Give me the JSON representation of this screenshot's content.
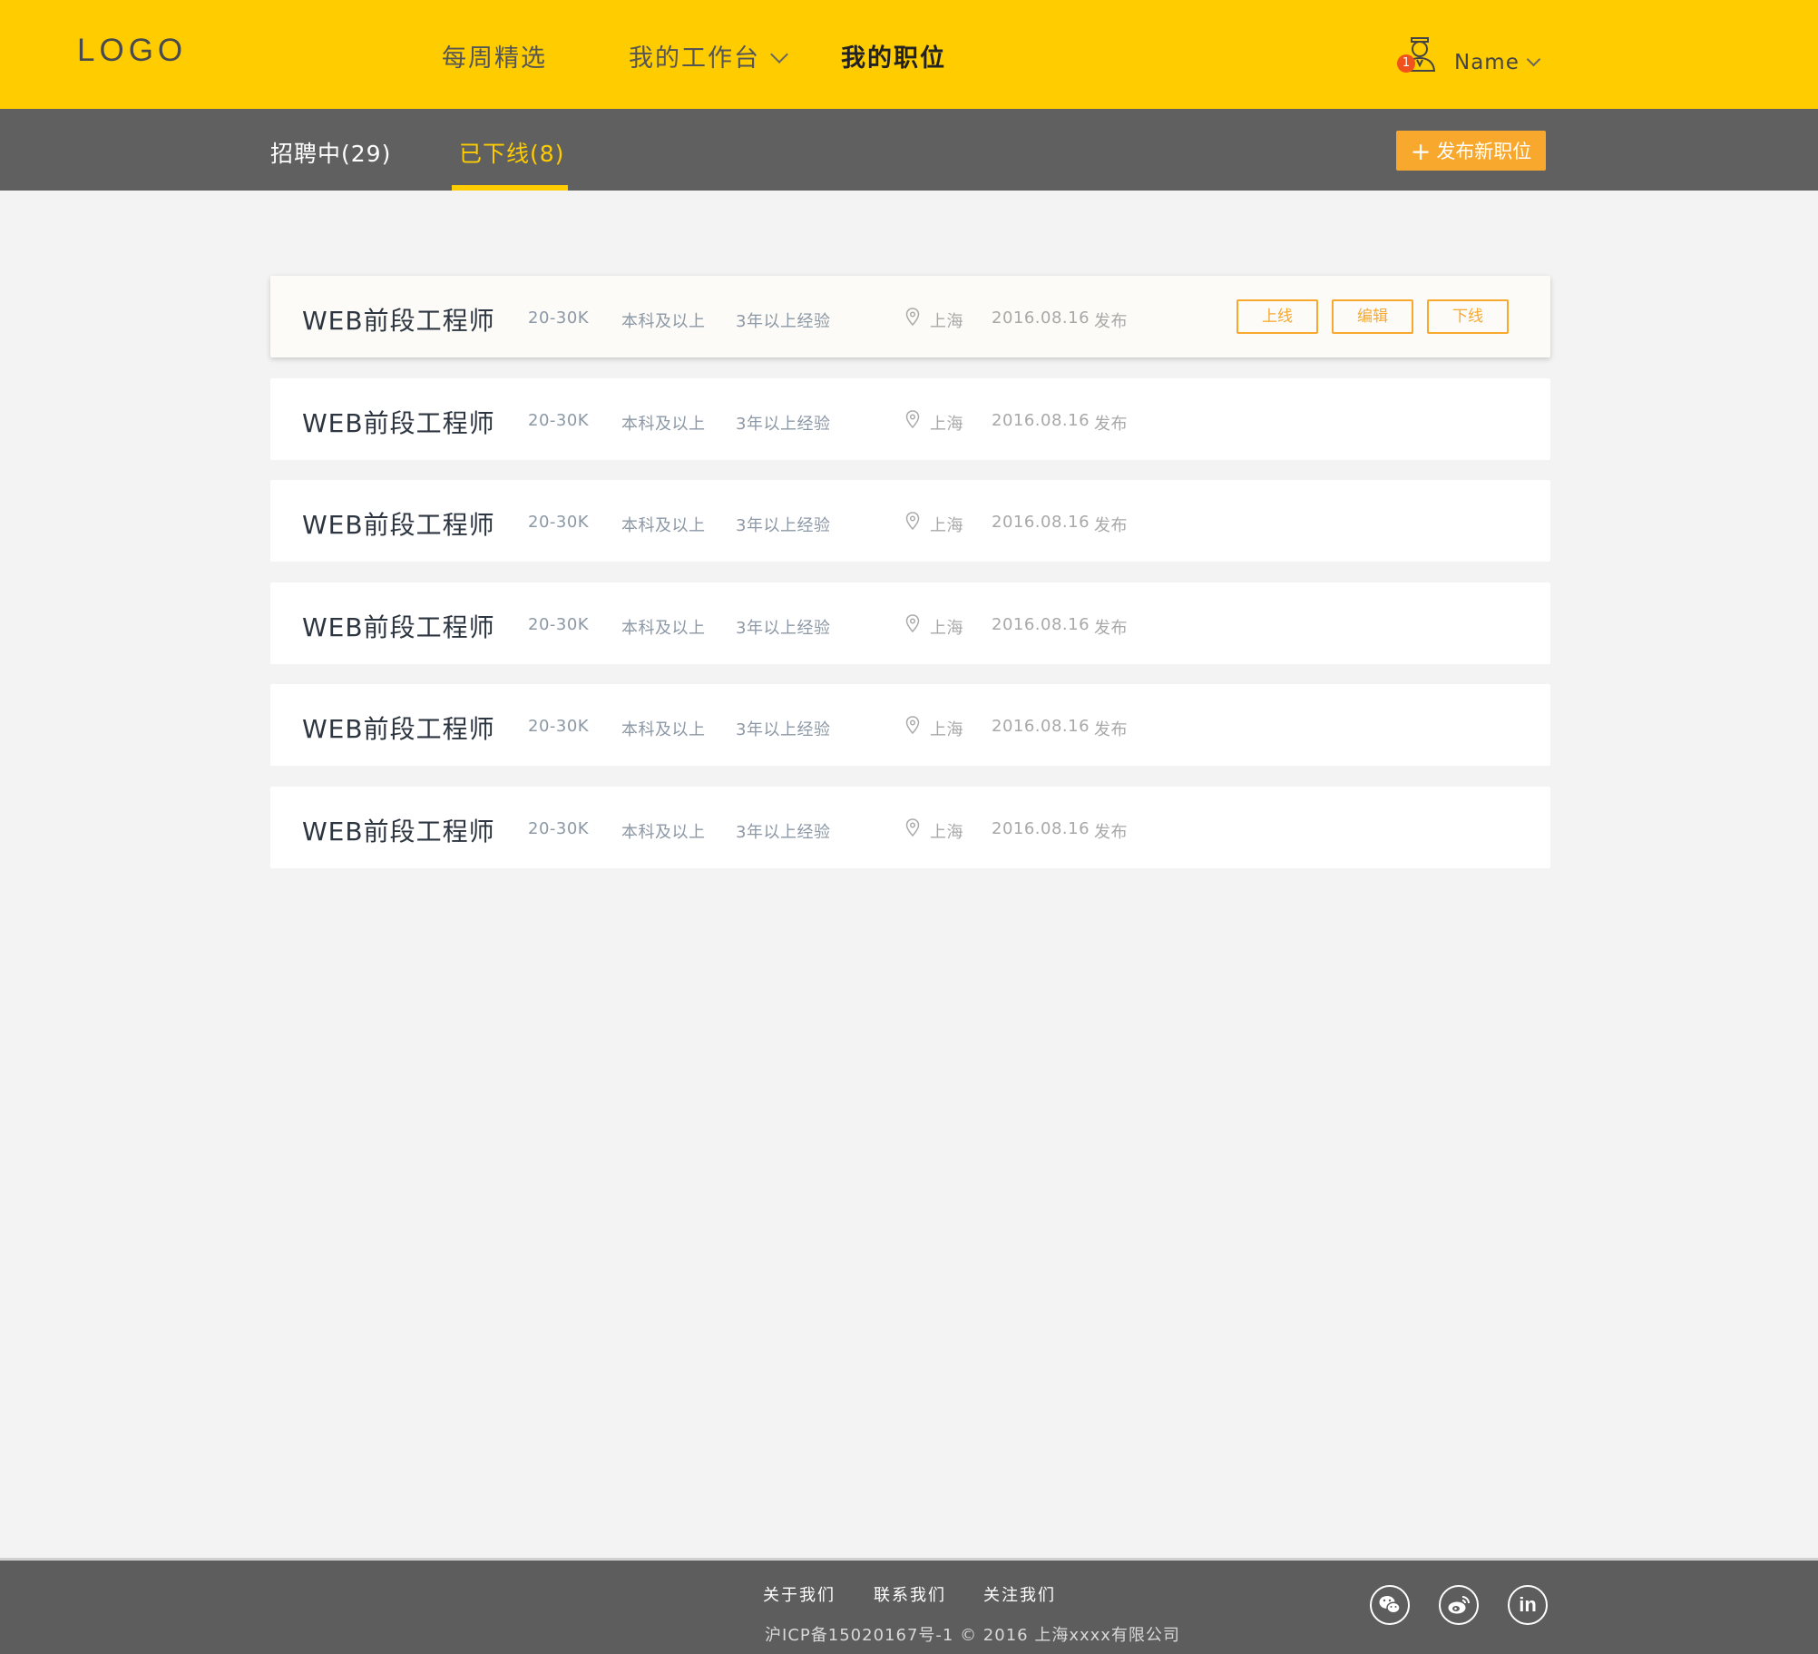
{
  "header": {
    "logo": "LOGO",
    "nav": [
      {
        "label": "每周精选"
      },
      {
        "label": "我的工作台"
      },
      {
        "label": "我的职位"
      }
    ],
    "user": {
      "name": "Name",
      "badge": "1"
    }
  },
  "subnav": {
    "tabs": [
      {
        "label": "招聘中(29)"
      },
      {
        "label": "已下线(8)"
      }
    ],
    "publish_label": "发布新职位",
    "publish_icon": "plus-icon"
  },
  "jobs": [
    {
      "title": "WEB前段工程师",
      "salary": "20-30K",
      "education": "本科及以上",
      "experience": "3年以上经验",
      "location": "上海",
      "date": "2016.08.16",
      "published": "发布"
    },
    {
      "title": "WEB前段工程师",
      "salary": "20-30K",
      "education": "本科及以上",
      "experience": "3年以上经验",
      "location": "上海",
      "date": "2016.08.16",
      "published": "发布"
    },
    {
      "title": "WEB前段工程师",
      "salary": "20-30K",
      "education": "本科及以上",
      "experience": "3年以上经验",
      "location": "上海",
      "date": "2016.08.16",
      "published": "发布"
    },
    {
      "title": "WEB前段工程师",
      "salary": "20-30K",
      "education": "本科及以上",
      "experience": "3年以上经验",
      "location": "上海",
      "date": "2016.08.16",
      "published": "发布"
    },
    {
      "title": "WEB前段工程师",
      "salary": "20-30K",
      "education": "本科及以上",
      "experience": "3年以上经验",
      "location": "上海",
      "date": "2016.08.16",
      "published": "发布"
    },
    {
      "title": "WEB前段工程师",
      "salary": "20-30K",
      "education": "本科及以上",
      "experience": "3年以上经验",
      "location": "上海",
      "date": "2016.08.16",
      "published": "发布"
    }
  ],
  "actions": {
    "online": "上线",
    "edit": "编辑",
    "offline": "下线"
  },
  "footer": {
    "links": [
      {
        "label": "关于我们"
      },
      {
        "label": "联系我们"
      },
      {
        "label": "关注我们"
      }
    ],
    "copyright": "沪ICP备15020167号-1 © 2016 上海xxxx有限公司",
    "social": [
      "wechat-icon",
      "weibo-icon",
      "linkedin-icon"
    ],
    "linkedin_text": "in"
  },
  "colors": {
    "brand_yellow": "#ffcc00",
    "accent_orange": "#f7a82d",
    "subbar_gray": "#606060",
    "footer_gray": "#5d5d5d",
    "badge_red": "#f0521c"
  }
}
